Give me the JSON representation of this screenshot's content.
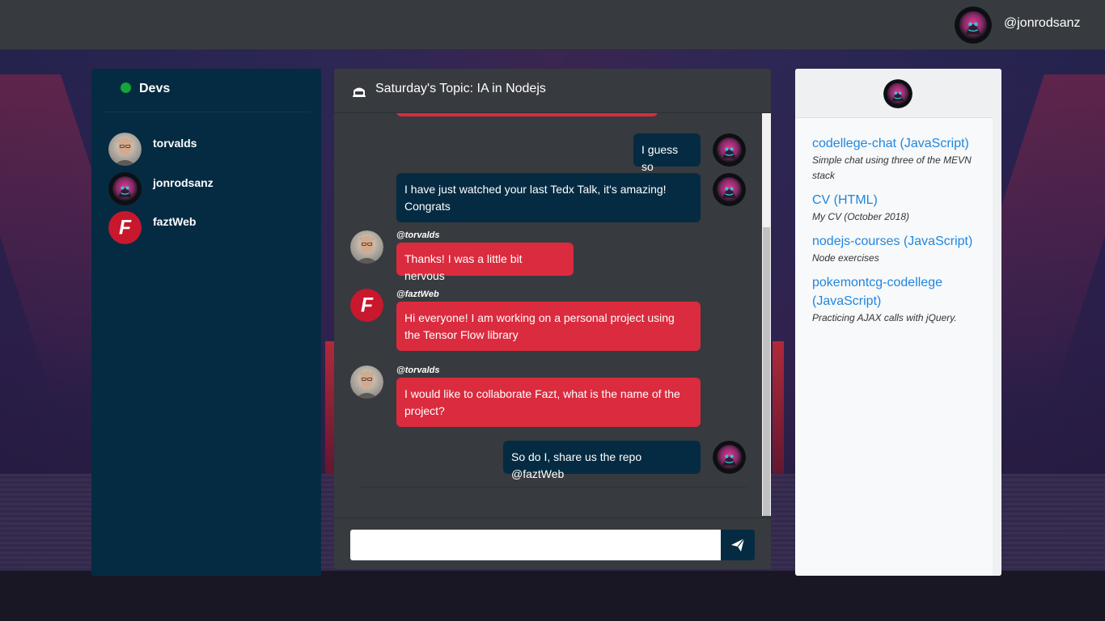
{
  "navbar": {
    "username": "@jonrodsanz"
  },
  "sidebar": {
    "channel": "Devs",
    "status_color": "#15a43a",
    "users": [
      {
        "name": "torvalds",
        "avatar": "torvalds-avatar"
      },
      {
        "name": "jonrodsanz",
        "avatar": "jonrodsanz-avatar"
      },
      {
        "name": "faztWeb",
        "avatar": "faztweb-avatar"
      }
    ]
  },
  "chat": {
    "topic": "Saturday's Topic: IA in  Nodejs",
    "messages": [
      {
        "sender": "",
        "text": "I guess so",
        "own": true
      },
      {
        "sender": "",
        "text": "I have just watched your last Tedx Talk, it's amazing! Congrats",
        "own": true
      },
      {
        "sender": "@torvalds",
        "text": "Thanks! I was a little bit nervous",
        "own": false
      },
      {
        "sender": "@faztWeb",
        "text": "Hi everyone! I am working on a personal project using the Tensor Flow library",
        "own": false
      },
      {
        "sender": "@torvalds",
        "text": "I would like to collaborate Fazt, what is the name of the project?",
        "own": false
      },
      {
        "sender": "",
        "text": "So do I, share us the repo @faztWeb",
        "own": true
      }
    ],
    "input": {
      "value": "",
      "placeholder": ""
    },
    "own_bubble_color": "#052b42",
    "other_bubble_color": "#db2b3e"
  },
  "repos": [
    {
      "name": "codellege-chat (JavaScript)",
      "description": "Simple chat using three of the MEVN stack"
    },
    {
      "name": "CV (HTML)",
      "description": "My CV (October 2018)"
    },
    {
      "name": "nodejs-courses (JavaScript)",
      "description": "Node exercises"
    },
    {
      "name": "pokemontcg-codellege (JavaScript)",
      "description": "Practicing AJAX calls with jQuery."
    }
  ],
  "icons": [
    "robot-icon",
    "send-icon"
  ]
}
